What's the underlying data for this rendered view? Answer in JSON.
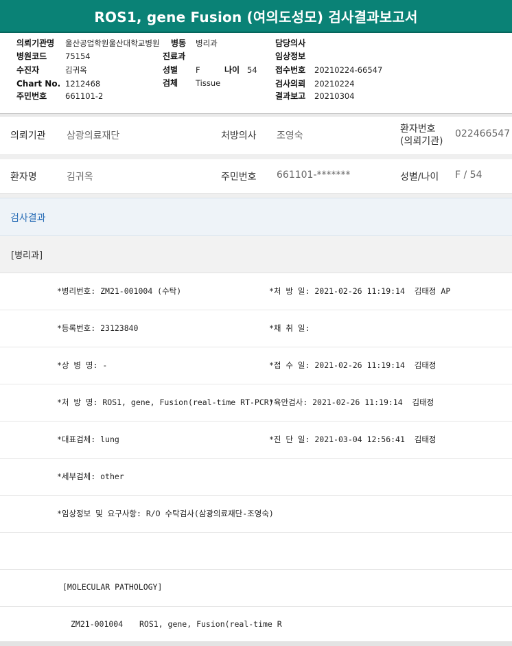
{
  "title": "ROS1, gene Fusion (여의도성모) 검사결과보고서",
  "header": {
    "col1": [
      {
        "label": "의뢰기관명",
        "value": "울산공업학원울산대학교병원"
      },
      {
        "label": "병원코드",
        "value": "75154"
      },
      {
        "label": "수진자",
        "value": "김귀옥"
      },
      {
        "label": "Chart No.",
        "value": "1212468"
      },
      {
        "label": "주민번호",
        "value": "661101-2"
      }
    ],
    "col2": {
      "ward_label": "병동",
      "ward_value": "병리과",
      "dept_label": "진료과",
      "sex_label": "성별",
      "sex_value": "F",
      "age_label": "나이",
      "age_value": "54",
      "specimen_label": "검체",
      "specimen_value": "Tissue"
    },
    "col3": [
      {
        "label": "담당의사",
        "value": ""
      },
      {
        "label": "임상정보",
        "value": ""
      },
      {
        "label": "접수번호",
        "value": "20210224-66547"
      },
      {
        "label": "검사의뢰",
        "value": "20210224"
      },
      {
        "label": "결과보고",
        "value": "20210304"
      }
    ]
  },
  "info": {
    "institution_label": "의뢰기관",
    "institution_value": "삼광의료재단",
    "doctor_label": "처방의사",
    "doctor_value": "조영숙",
    "patient_no_label_1": "환자번호",
    "patient_no_label_2": "(의뢰기관)",
    "patient_no_value": "022466547",
    "patient_name_label": "환자명",
    "patient_name_value": "김귀옥",
    "resident_no_label": "주민번호",
    "resident_no_value": "661101-*******",
    "sex_age_label": "성별/나이",
    "sex_age_value": "F / 54"
  },
  "results": {
    "section_title": "검사결과",
    "dept": "[병리과]",
    "rows": [
      {
        "left": "*병리번호: ZM21-001004 (수탁)",
        "right": "*처 방 일: 2021-02-26 11:19:14  김태정 AP"
      },
      {
        "left": "*등록번호: 23123840",
        "right": "*채 취 일:"
      },
      {
        "left": "*상 병 명: -",
        "right": "*접 수 일: 2021-02-26 11:19:14  김태정"
      },
      {
        "left": "*처 방 명: ROS1, gene, Fusion(real-time RT-PCR)",
        "right": "*육안검사: 2021-02-26 11:19:14  김태정"
      },
      {
        "left": "*대표검체: lung",
        "right": "*진 단 일: 2021-03-04 12:56:41  김태정"
      },
      {
        "left": "*세부검체: other",
        "right": ""
      },
      {
        "left": "*임상정보 및 요구사항: R/O 수탁검사(삼광의료재단-조영숙)",
        "right": ""
      }
    ],
    "molecular_header": "[MOLECULAR PATHOLOGY]",
    "molecular_code": "ZM21-001004",
    "molecular_test": "ROS1, gene, Fusion(real-time R"
  }
}
